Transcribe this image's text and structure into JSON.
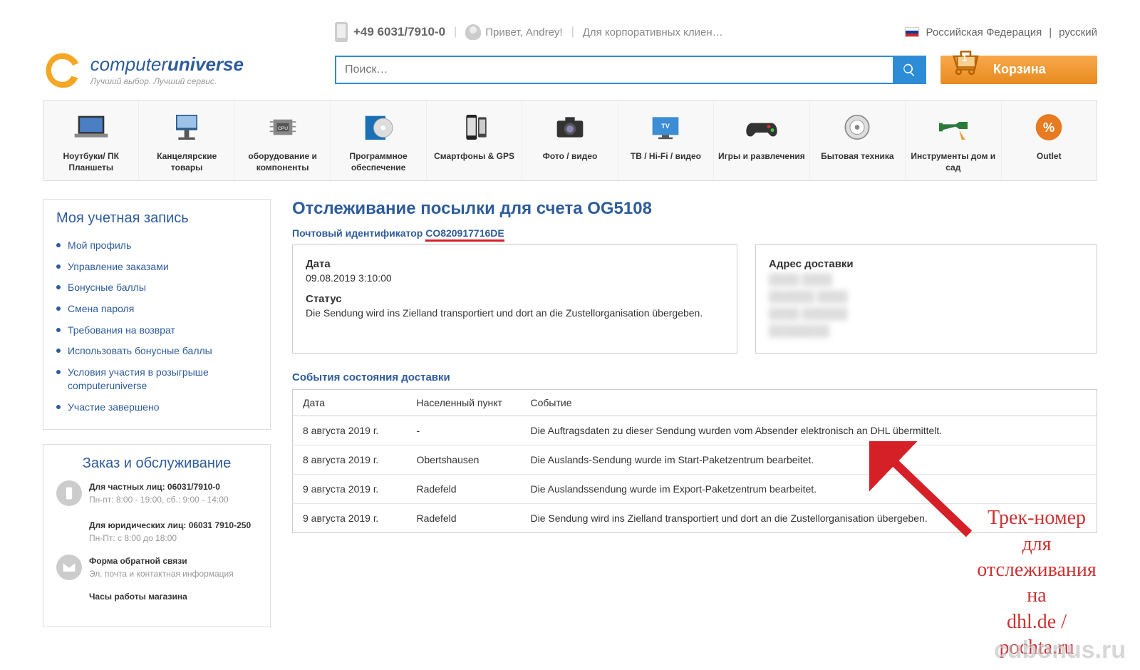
{
  "header": {
    "phone": "+49 6031/7910-0",
    "greeting": "Привет, Andrey!",
    "corporate": "Для корпоративных клиен…",
    "country": "Российская Федерация",
    "language": "русский",
    "logo_prefix": "computer",
    "logo_bold": "universe",
    "tagline": "Лучший выбор. Лучший сервис.",
    "search_placeholder": "Поиск…",
    "cart_label": "Корзина",
    "cart_count": "1"
  },
  "categories": [
    {
      "label": "Ноутбуки/ ПК Планшеты"
    },
    {
      "label": "Канцелярские товары"
    },
    {
      "label": "оборудование и компоненты"
    },
    {
      "label": "Программное обеспечение"
    },
    {
      "label": "Смартфоны & GPS"
    },
    {
      "label": "Фото / видео"
    },
    {
      "label": "ТВ / Hi-Fi / видео"
    },
    {
      "label": "Игры и развлечения"
    },
    {
      "label": "Бытовая техника"
    },
    {
      "label": "Инструменты дом и сад"
    },
    {
      "label": "Outlet"
    }
  ],
  "sidebar": {
    "account_title": "Моя учетная запись",
    "account_items": [
      "Мой профиль",
      "Управление заказами",
      "Бонусные баллы",
      "Смена пароля",
      "Требования на возврат",
      "Использовать бонусные баллы",
      "Условия участия в розыгрыше computeruniverse",
      "Участие завершено"
    ],
    "support_title": "Заказ и обслуживание",
    "support1_line1": "Для частных лиц: 06031/7910-0",
    "support1_line2": "Пн-пт: 8:00 - 19:00, сб.: 9:00 - 14:00",
    "support2_line1": "Для юридических лиц: 06031 7910-250",
    "support2_line2": "Пн-Пт: с 8:00 до 18:00",
    "support3_line1": "Форма обратной связи",
    "support3_line2": "Эл. почта и контактная информация",
    "support4": "Часы работы магазина"
  },
  "main": {
    "title": "Отслеживание посылки для счета OG5108",
    "tracking_label": "Почтовый идентификатор ",
    "tracking_id": "CO820917716DE",
    "date_label": "Дата",
    "date_value": "09.08.2019 3:10:00",
    "status_label": "Статус",
    "status_value": "Die Sendung wird ins Zielland transportiert und dort an die Zustellorganisation übergeben.",
    "address_label": "Адрес доставки",
    "events_title": "События состояния доставки",
    "events_headers": {
      "date": "Дата",
      "place": "Населенный пункт",
      "event": "Событие"
    },
    "events": [
      {
        "date": "8 августа 2019 г.",
        "place": "-",
        "event": "Die Auftragsdaten zu dieser Sendung wurden vom Absender elektronisch an DHL übermittelt."
      },
      {
        "date": "8 августа 2019 г.",
        "place": "Obertshausen",
        "event": "Die Auslands-Sendung wurde im Start-Paketzentrum bearbeitet."
      },
      {
        "date": "9 августа 2019 г.",
        "place": "Radefeld",
        "event": "Die Auslandssendung wurde im Export-Paketzentrum bearbeitet."
      },
      {
        "date": "9 августа 2019 г.",
        "place": "Radefeld",
        "event": "Die Sendung wird ins Zielland transportiert und dort an die Zustellorganisation übergeben."
      }
    ]
  },
  "annotation": "Трек-номер для\nотслеживания на\ndhl.de / pochta.ru",
  "watermark": "cubonus.ru"
}
